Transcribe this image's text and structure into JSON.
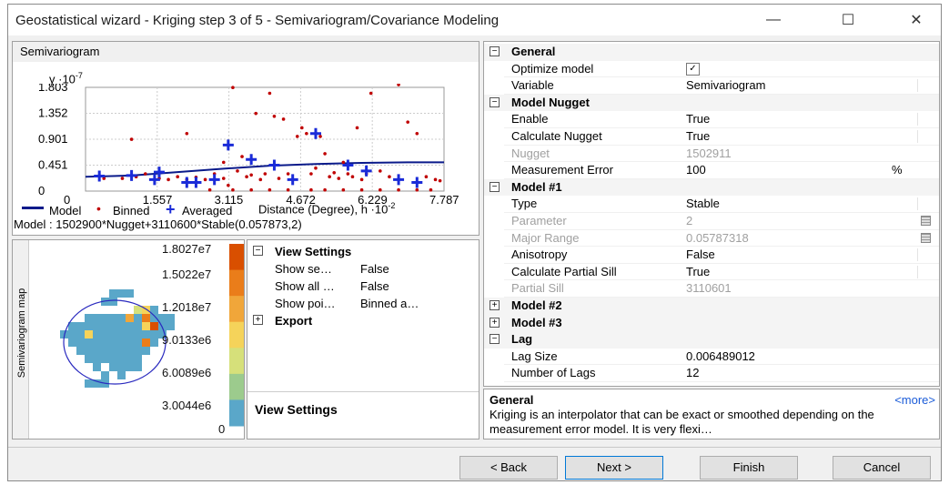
{
  "window": {
    "title": "Geostatistical wizard - Kriging step 3 of 5 - Semivariogram/Covariance Modeling",
    "minimize_glyph": "—",
    "maximize_glyph": "☐",
    "close_glyph": "✕"
  },
  "semivariogram": {
    "header": "Semivariogram",
    "y_axis_label": "γ ·10",
    "y_axis_exp": "-7",
    "x_axis_label": "Distance (Degree), h ·10",
    "x_axis_exp": "-2",
    "legend": {
      "model": "Model",
      "binned": "Binned",
      "averaged": "Averaged"
    },
    "model_equation": "Model : 1502900*Nugget+3110600*Stable(0.057873,2)"
  },
  "chart_data": {
    "type": "scatter",
    "x_ticks": [
      "0",
      "1.557",
      "3.115",
      "4.672",
      "6.229",
      "7.787"
    ],
    "y_ticks": [
      "1.803",
      "1.352",
      "0.901",
      "0.451",
      "0"
    ],
    "xlim": [
      0,
      7.787
    ],
    "ylim": [
      0,
      1.803
    ],
    "series": [
      {
        "name": "Binned",
        "color": "#c00000",
        "points": [
          [
            0.4,
            0.22
          ],
          [
            0.8,
            0.22
          ],
          [
            1.1,
            0.25
          ],
          [
            1.3,
            0.3
          ],
          [
            1.6,
            0.22
          ],
          [
            1.8,
            0.2
          ],
          [
            2.0,
            0.25
          ],
          [
            2.2,
            0.2
          ],
          [
            2.4,
            0.24
          ],
          [
            2.6,
            0.2
          ],
          [
            2.8,
            0.3
          ],
          [
            3.0,
            0.22
          ],
          [
            3.1,
            0.1
          ],
          [
            3.2,
            1.8
          ],
          [
            3.3,
            0.35
          ],
          [
            3.4,
            0.6
          ],
          [
            3.5,
            0.25
          ],
          [
            3.6,
            0.28
          ],
          [
            3.7,
            1.35
          ],
          [
            3.8,
            0.2
          ],
          [
            3.9,
            0.3
          ],
          [
            4.0,
            1.7
          ],
          [
            4.1,
            1.3
          ],
          [
            4.2,
            0.22
          ],
          [
            4.3,
            1.25
          ],
          [
            4.4,
            0.3
          ],
          [
            4.5,
            0.2
          ],
          [
            4.6,
            0.95
          ],
          [
            4.7,
            1.1
          ],
          [
            4.8,
            1.0
          ],
          [
            4.9,
            0.3
          ],
          [
            5.0,
            0.4
          ],
          [
            5.1,
            0.95
          ],
          [
            5.2,
            0.65
          ],
          [
            5.3,
            0.25
          ],
          [
            5.4,
            0.32
          ],
          [
            5.5,
            0.22
          ],
          [
            5.6,
            0.5
          ],
          [
            5.7,
            0.3
          ],
          [
            5.8,
            0.25
          ],
          [
            5.9,
            1.1
          ],
          [
            6.0,
            0.2
          ],
          [
            6.1,
            0.3
          ],
          [
            6.2,
            1.7
          ],
          [
            6.4,
            0.35
          ],
          [
            6.6,
            0.25
          ],
          [
            6.8,
            1.85
          ],
          [
            7.0,
            1.2
          ],
          [
            7.2,
            1.0
          ],
          [
            7.4,
            0.25
          ],
          [
            7.6,
            0.2
          ],
          [
            7.7,
            0.18
          ],
          [
            1.0,
            0.9
          ],
          [
            2.2,
            1.0
          ],
          [
            3.0,
            0.5
          ],
          [
            4.9,
            0.02
          ],
          [
            5.2,
            0.02
          ],
          [
            5.6,
            0.02
          ],
          [
            6.0,
            0.02
          ],
          [
            6.4,
            0.02
          ],
          [
            6.8,
            0.02
          ],
          [
            7.2,
            0.02
          ],
          [
            7.5,
            0.02
          ],
          [
            2.7,
            0.02
          ],
          [
            3.2,
            0.02
          ],
          [
            3.6,
            0.02
          ],
          [
            4.0,
            0.02
          ],
          [
            4.4,
            0.02
          ]
        ]
      },
      {
        "name": "Averaged",
        "color": "#1a2bd8",
        "points": [
          [
            0.3,
            0.26
          ],
          [
            1.0,
            0.27
          ],
          [
            1.5,
            0.2
          ],
          [
            1.6,
            0.33
          ],
          [
            2.4,
            0.15
          ],
          [
            2.8,
            0.2
          ],
          [
            3.1,
            0.8
          ],
          [
            3.6,
            0.55
          ],
          [
            4.1,
            0.45
          ],
          [
            5.0,
            1.0
          ],
          [
            5.7,
            0.45
          ],
          [
            6.1,
            0.35
          ],
          [
            6.8,
            0.2
          ],
          [
            7.2,
            0.15
          ],
          [
            4.5,
            0.2
          ],
          [
            2.2,
            0.15
          ]
        ]
      },
      {
        "name": "Model",
        "color": "#0a1a8a",
        "points": [
          [
            0,
            0.25
          ],
          [
            1,
            0.27
          ],
          [
            2,
            0.33
          ],
          [
            3,
            0.39
          ],
          [
            4,
            0.44
          ],
          [
            5,
            0.47
          ],
          [
            6,
            0.49
          ],
          [
            7,
            0.5
          ],
          [
            7.787,
            0.5
          ]
        ]
      }
    ]
  },
  "map": {
    "axis_label": "Semivariogram map",
    "scale_labels": [
      "1.8027e7",
      "1.5022e7",
      "1.2018e7",
      "9.0133e6",
      "6.0089e6",
      "3.0044e6",
      "0"
    ],
    "scale_colors": [
      "#d94f00",
      "#ea7d1a",
      "#f0a63a",
      "#f5d35a",
      "#d6e07a",
      "#9ccb8d",
      "#5aa7c9"
    ]
  },
  "view_settings_grid": {
    "category": "View Settings",
    "rows": [
      {
        "label": "Show se…",
        "value": "False"
      },
      {
        "label": "Show all …",
        "value": "False"
      },
      {
        "label": "Show poi…",
        "value": "Binned a…"
      }
    ],
    "export_label": "Export",
    "footer_title": "View Settings"
  },
  "property_grid": {
    "rows": [
      {
        "kind": "cat",
        "exp": "⊟",
        "label": "General"
      },
      {
        "kind": "prop",
        "label": "Optimize model",
        "value": "",
        "icon": "optimize-icon"
      },
      {
        "kind": "prop",
        "label": "Variable",
        "value": "Semivariogram",
        "dropdown": true
      },
      {
        "kind": "cat",
        "exp": "⊟",
        "label": "Model Nugget"
      },
      {
        "kind": "prop",
        "label": "Enable",
        "value": "True",
        "dropdown": true
      },
      {
        "kind": "prop",
        "label": "Calculate Nugget",
        "value": "True",
        "dropdown": true
      },
      {
        "kind": "dis",
        "label": "Nugget",
        "value": "1502911"
      },
      {
        "kind": "prop",
        "label": "Measurement Error",
        "value": "100",
        "unit": "%"
      },
      {
        "kind": "cat",
        "exp": "⊟",
        "label": "Model #1"
      },
      {
        "kind": "prop",
        "label": "Type",
        "value": "Stable",
        "dropdown": true
      },
      {
        "kind": "dis",
        "label": "Parameter",
        "value": "2",
        "btn": true
      },
      {
        "kind": "dis",
        "label": "Major Range",
        "value": "0.05787318",
        "btn": true
      },
      {
        "kind": "prop",
        "label": "Anisotropy",
        "value": "False",
        "dropdown": true
      },
      {
        "kind": "prop",
        "label": "Calculate Partial Sill",
        "value": "True",
        "dropdown": true
      },
      {
        "kind": "dis",
        "label": "Partial Sill",
        "value": "3110601"
      },
      {
        "kind": "cat",
        "exp": "⊞",
        "label": "Model #2"
      },
      {
        "kind": "cat",
        "exp": "⊞",
        "label": "Model #3"
      },
      {
        "kind": "cat",
        "exp": "⊟",
        "label": "Lag"
      },
      {
        "kind": "prop",
        "label": "Lag Size",
        "value": "0.006489012"
      },
      {
        "kind": "prop",
        "label": "Number of Lags",
        "value": "12"
      }
    ],
    "help_title": "General",
    "help_more": "<more>",
    "help_text": "Kriging is an interpolator that can be exact or smoothed depending on the measurement error model. It is very flexi…"
  },
  "buttons": {
    "back": "< Back",
    "next": "Next >",
    "finish": "Finish",
    "cancel": "Cancel"
  }
}
